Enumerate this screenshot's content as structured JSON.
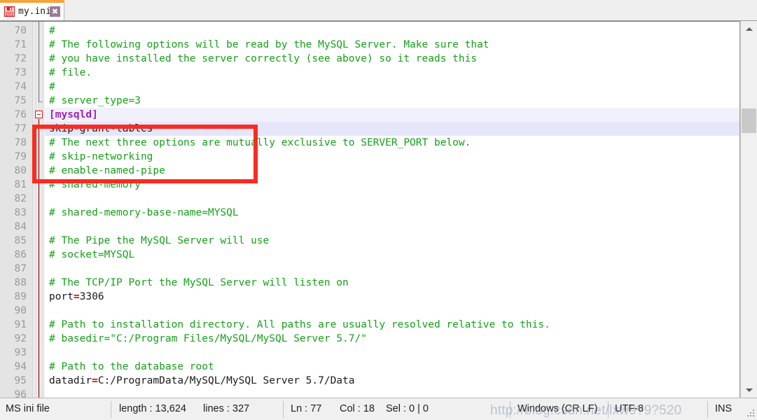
{
  "tab": {
    "label": "my.ini",
    "save_icon": "floppy-disk-icon",
    "close_label": "✖"
  },
  "editor": {
    "first_visible_line": 70,
    "current_line": 77,
    "fold_open_line": 76,
    "lines": [
      {
        "n": 70,
        "tokens": [
          {
            "t": "#",
            "c": "cmt"
          }
        ]
      },
      {
        "n": 71,
        "tokens": [
          {
            "t": "# The following options will be read by the MySQL Server. Make sure that",
            "c": "cmt"
          }
        ]
      },
      {
        "n": 72,
        "tokens": [
          {
            "t": "# you have installed the server correctly (see above) so it reads this",
            "c": "cmt"
          }
        ]
      },
      {
        "n": 73,
        "tokens": [
          {
            "t": "# file.",
            "c": "cmt"
          }
        ]
      },
      {
        "n": 74,
        "tokens": [
          {
            "t": "#",
            "c": "cmt"
          }
        ]
      },
      {
        "n": 75,
        "tokens": [
          {
            "t": "# server_type=3",
            "c": "cmt"
          }
        ]
      },
      {
        "n": 76,
        "tokens": [
          {
            "t": "[mysqld]",
            "c": "sect"
          }
        ],
        "highlight": "soft"
      },
      {
        "n": 77,
        "tokens": [
          {
            "t": "skip-grant-tables",
            "c": "plain"
          }
        ],
        "highlight": "cur"
      },
      {
        "n": 78,
        "tokens": [
          {
            "t": "# The next three options are mutually exclusive to SERVER_PORT below.",
            "c": "cmt"
          }
        ]
      },
      {
        "n": 79,
        "tokens": [
          {
            "t": "# skip-networking",
            "c": "cmt"
          }
        ]
      },
      {
        "n": 80,
        "tokens": [
          {
            "t": "# enable-named-pipe",
            "c": "cmt"
          }
        ]
      },
      {
        "n": 81,
        "tokens": [
          {
            "t": "# shared-memory",
            "c": "cmt"
          }
        ]
      },
      {
        "n": 82,
        "tokens": []
      },
      {
        "n": 83,
        "tokens": [
          {
            "t": "# shared-memory-base-name=MYSQL",
            "c": "cmt"
          }
        ]
      },
      {
        "n": 84,
        "tokens": []
      },
      {
        "n": 85,
        "tokens": [
          {
            "t": "# The Pipe the MySQL Server will use",
            "c": "cmt"
          }
        ]
      },
      {
        "n": 86,
        "tokens": [
          {
            "t": "# socket=MYSQL",
            "c": "cmt"
          }
        ]
      },
      {
        "n": 87,
        "tokens": []
      },
      {
        "n": 88,
        "tokens": [
          {
            "t": "# The TCP/IP Port the MySQL Server will listen on",
            "c": "cmt"
          }
        ]
      },
      {
        "n": 89,
        "tokens": [
          {
            "t": "port",
            "c": "key"
          },
          {
            "t": "=",
            "c": "eq"
          },
          {
            "t": "3306",
            "c": "val"
          }
        ]
      },
      {
        "n": 90,
        "tokens": []
      },
      {
        "n": 91,
        "tokens": [
          {
            "t": "# Path to installation directory. All paths are usually resolved relative to this.",
            "c": "cmt"
          }
        ]
      },
      {
        "n": 92,
        "tokens": [
          {
            "t": "# basedir=\"C:/Program Files/MySQL/MySQL Server 5.7/\"",
            "c": "cmt"
          }
        ]
      },
      {
        "n": 93,
        "tokens": []
      },
      {
        "n": 94,
        "tokens": [
          {
            "t": "# Path to the database root",
            "c": "cmt"
          }
        ]
      },
      {
        "n": 95,
        "tokens": [
          {
            "t": "datadir",
            "c": "key"
          },
          {
            "t": "=",
            "c": "eq"
          },
          {
            "t": "C:/ProgramData/MySQL/MySQL Server 5.7/Data",
            "c": "val"
          }
        ]
      },
      {
        "n": 96,
        "tokens": []
      }
    ]
  },
  "annotation": {
    "type": "red-rectangle-highlight",
    "color": "#fb2b21",
    "covers_lines": "76-79"
  },
  "scrollbar": {
    "up_arrow": "chevron-up-icon",
    "down_arrow": "chevron-down-icon"
  },
  "statusbar": {
    "filetype": "MS ini file",
    "length_label": "length : 13,624",
    "lines_label": "lines : 327",
    "ln_label": "Ln : 77",
    "col_label": "Col : 18",
    "sel_label": "Sel : 0 | 0",
    "eol": "Windows (CR LF)",
    "encoding": "UTF-8",
    "insert_mode": "INS"
  },
  "watermark": {
    "text": "http://blog.csdn.net/lxw9?9?520"
  },
  "colors": {
    "tab_accent": "#f5a33c",
    "comment_green": "#17a01a",
    "section_purple": "#a020b0",
    "equals_red": "#e00000",
    "annotation_red": "#fb2b21",
    "gutter_bg": "#e4e4e4",
    "current_line": "#e6e6fa"
  }
}
